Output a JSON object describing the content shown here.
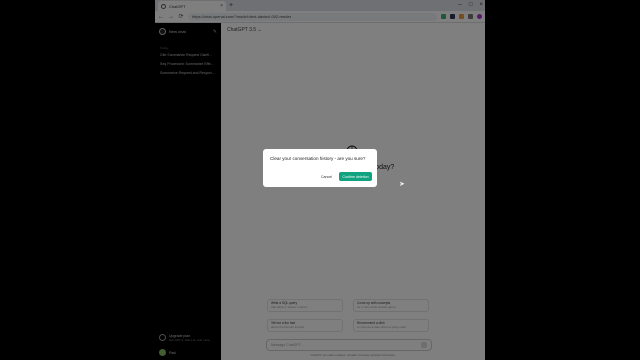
{
  "browser": {
    "tab_title": "ChatGPT",
    "tab_close": "×",
    "new_tab": "+",
    "window_controls": [
      "–",
      "□",
      "×"
    ],
    "url": "https://chat.openai.com/?model=text-davinci-002-render",
    "nav": [
      "←",
      "→",
      "⟳"
    ]
  },
  "sidebar": {
    "new_chat": "New chat",
    "section": "Today",
    "history": [
      "Gite Summarize Request Clarifi...",
      "Seq Processed: Summarize Effe...",
      "Summarize Request and Respon..."
    ],
    "upgrade_title": "Upgrade plan",
    "upgrade_sub": "Get GPT-4, DALL·E, and more",
    "user_name": "Paul"
  },
  "main": {
    "model_label": "ChatGPT 3.5 ⌄",
    "headline": "How can I help you today?",
    "suggestions": [
      {
        "title": "Write a SQL query",
        "sub": "that adds a \"status\" column"
      },
      {
        "title": "Come up with concepts",
        "sub": "for a retro-style arcade game"
      },
      {
        "title": "Tell me a fun fact",
        "sub": "about the Roman Empire"
      },
      {
        "title": "Recommend a dish",
        "sub": "to impress a date who's a picky eater"
      }
    ],
    "message_placeholder": "Message ChatGPT...",
    "footer": "ChatGPT can make mistakes. Consider checking important information."
  },
  "dialog": {
    "text": "Clear your conversation history - are you sure?",
    "cancel_label": "Cancel",
    "confirm_label": "Confirm deletion"
  },
  "colors": {
    "accent": "#10a37f",
    "sidebar_bg": "#000000",
    "overlay": "rgba(0,0,0,0.5)"
  },
  "icons": [
    "edit-icon",
    "openai-logo-icon",
    "send-icon",
    "cursor-icon"
  ]
}
